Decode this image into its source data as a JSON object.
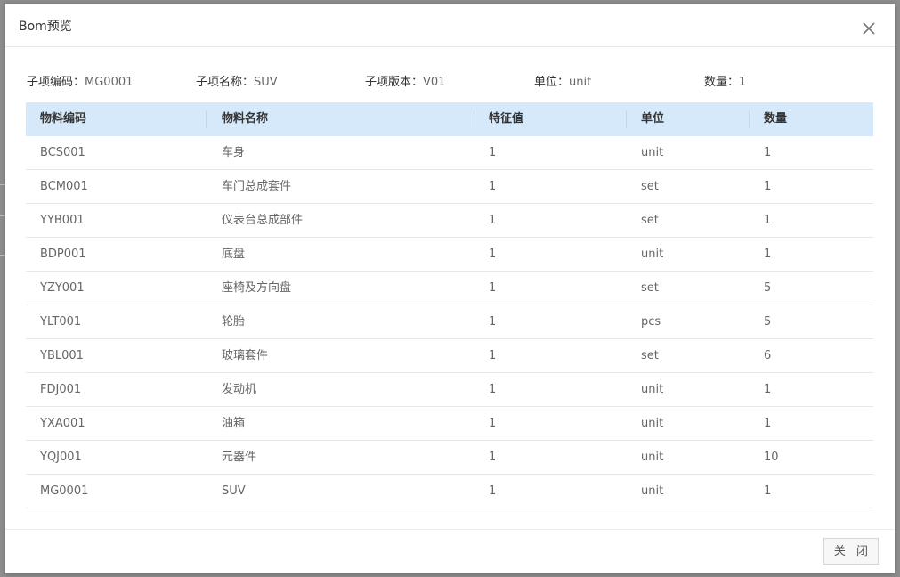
{
  "dialog": {
    "title": "Bom预览",
    "close_icon": "close-icon",
    "footer_close_label": "关 闭"
  },
  "info": {
    "code_label": "子项编码：",
    "code_value": "MG0001",
    "name_label": "子项名称：",
    "name_value": "SUV",
    "version_label": "子项版本：",
    "version_value": "V01",
    "unit_label": "单位：",
    "unit_value": "unit",
    "qty_label": "数量：",
    "qty_value": "1"
  },
  "table": {
    "headers": [
      "物料编码",
      "物料名称",
      "特征值",
      "单位",
      "数量"
    ],
    "rows": [
      [
        "BCS001",
        "车身",
        "1",
        "unit",
        "1"
      ],
      [
        "BCM001",
        "车门总成套件",
        "1",
        "set",
        "1"
      ],
      [
        "YYB001",
        "仪表台总成部件",
        "1",
        "set",
        "1"
      ],
      [
        "BDP001",
        "底盘",
        "1",
        "unit",
        "1"
      ],
      [
        "YZY001",
        "座椅及方向盘",
        "1",
        "set",
        "5"
      ],
      [
        "YLT001",
        "轮胎",
        "1",
        "pcs",
        "5"
      ],
      [
        "YBL001",
        "玻璃套件",
        "1",
        "set",
        "6"
      ],
      [
        "FDJ001",
        "发动机",
        "1",
        "unit",
        "1"
      ],
      [
        "YXA001",
        "油箱",
        "1",
        "unit",
        "1"
      ],
      [
        "YQJ001",
        "元器件",
        "1",
        "unit",
        "10"
      ],
      [
        "MG0001",
        "SUV",
        "1",
        "unit",
        "1"
      ]
    ]
  },
  "colors": {
    "header_bg": "#d6e9fb",
    "row_border": "#e8e8e8",
    "text_muted": "#666666"
  }
}
